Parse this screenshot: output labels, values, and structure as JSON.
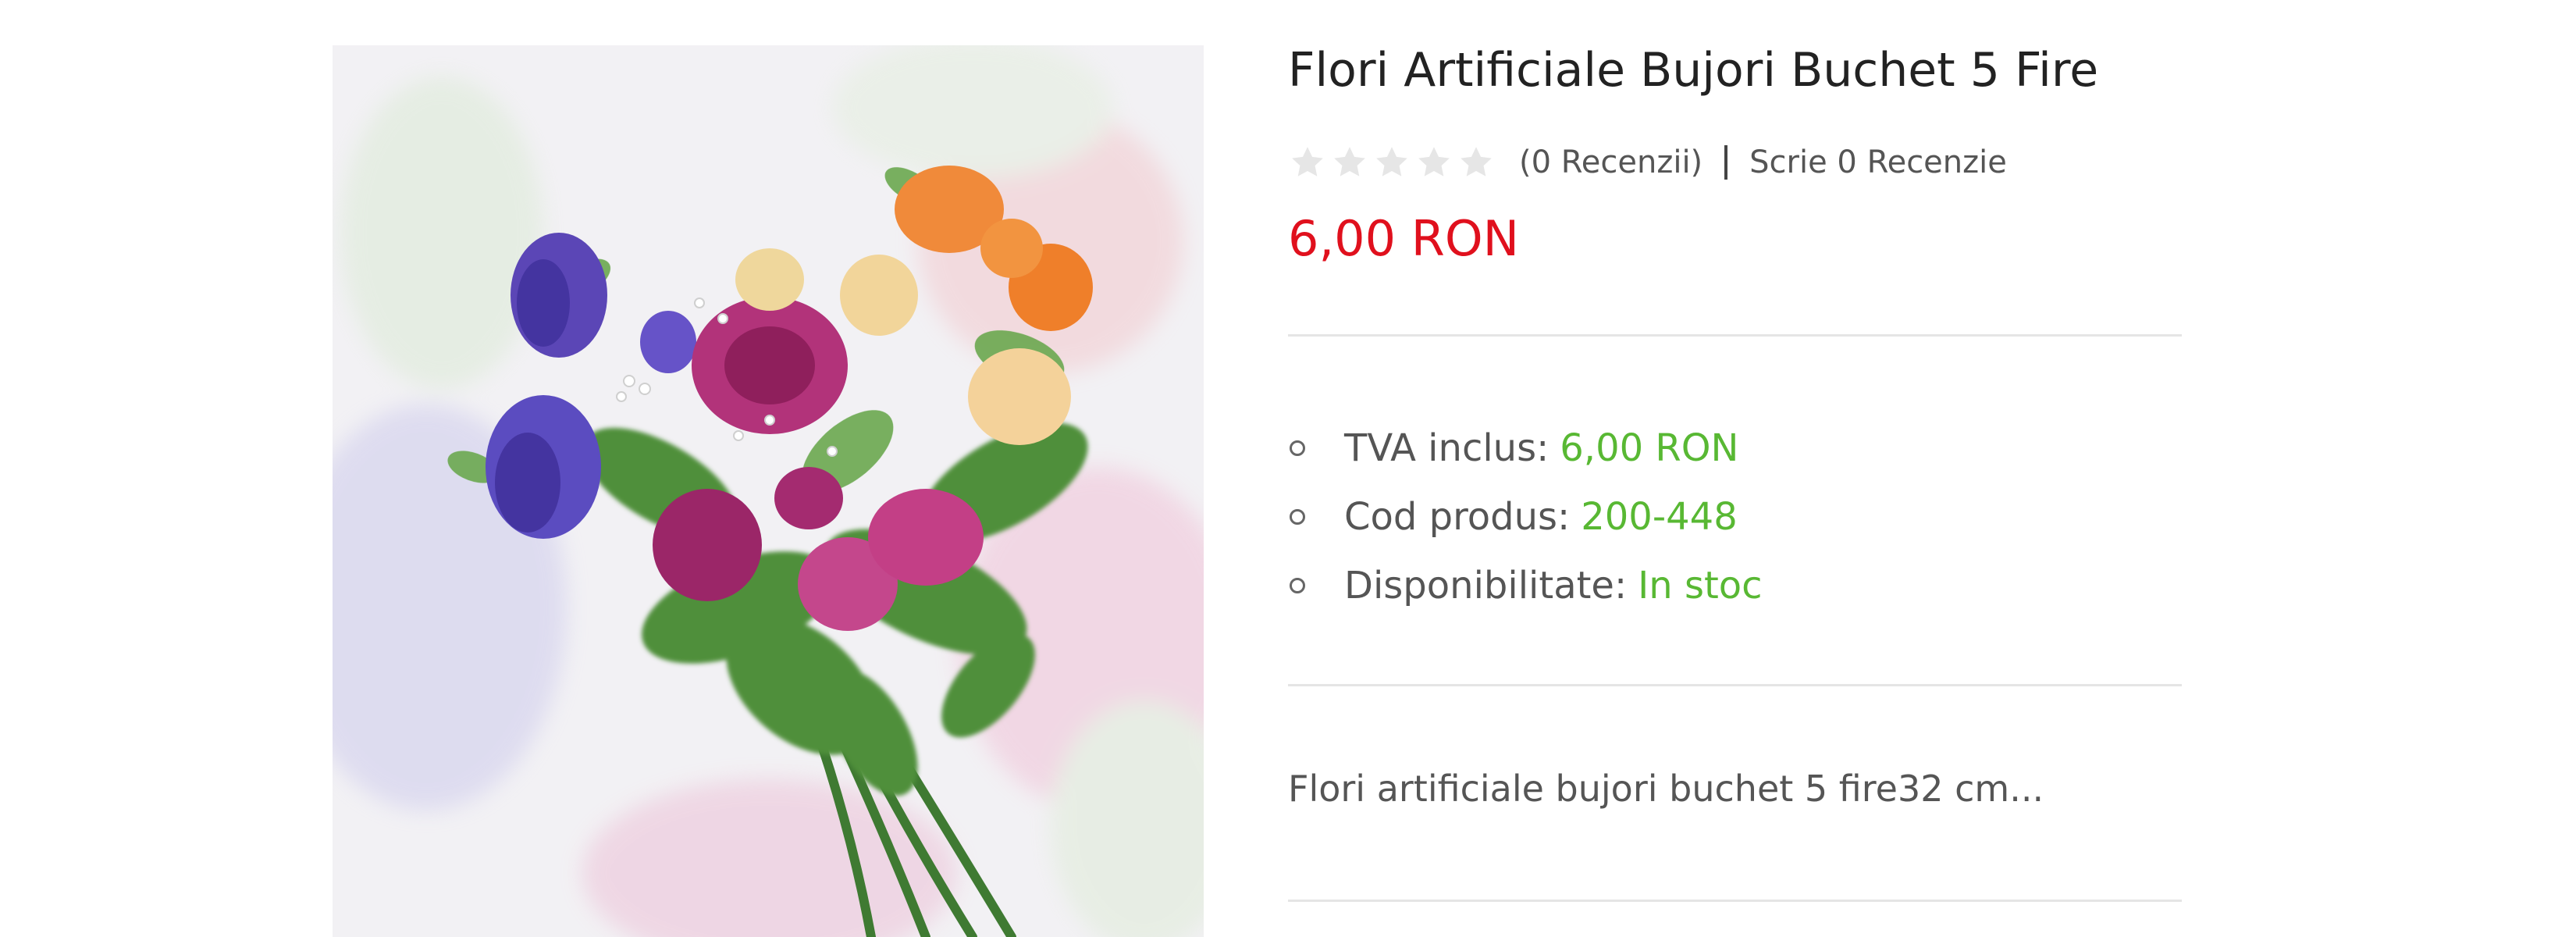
{
  "product": {
    "title": "Flori Artificiale Bujori Buchet 5 Fire",
    "image_alt": "Flori Artificiale Bujori Buchet 5 Fire",
    "rating": {
      "stars_filled": 0,
      "stars_total": 5,
      "reviews_text": "(0 Recenzii)",
      "write_review_text": "Scrie 0 Recenzie"
    },
    "price": "6,00 RON",
    "specs": [
      {
        "label": "TVA inclus:",
        "value": "6,00 RON"
      },
      {
        "label": "Cod produs:",
        "value": "200-448"
      },
      {
        "label": "Disponibilitate:",
        "value": "In stoc"
      }
    ],
    "description": "Flori artificiale bujori buchet 5 fire32 cm..."
  },
  "colors": {
    "price": "#e0101d",
    "spec_value": "#58b833",
    "star_empty": "#e6e6e6"
  }
}
